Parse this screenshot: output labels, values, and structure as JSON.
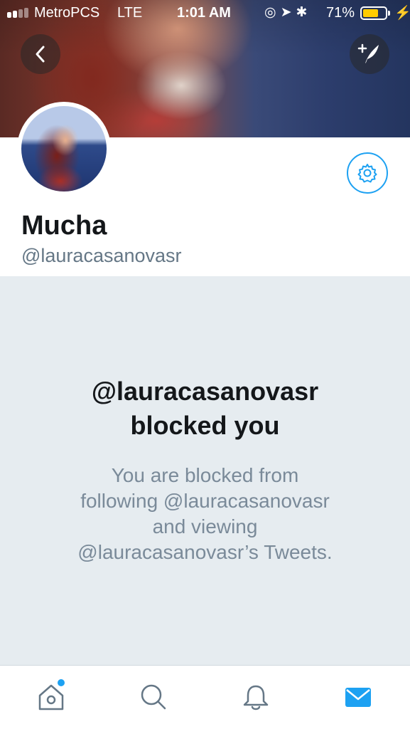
{
  "status_bar": {
    "carrier": "MetroPCS",
    "network": "LTE",
    "time": "1:01 AM",
    "battery_percent": "71%",
    "battery_level": 0.71,
    "icons": [
      "signal-icon",
      "lock-rotation-icon",
      "location-icon",
      "bluetooth-icon",
      "battery-icon",
      "charging-icon"
    ]
  },
  "header": {
    "back_icon": "back-arrow-icon",
    "compose_icon": "compose-tweet-icon"
  },
  "profile": {
    "display_name": "Mucha",
    "handle": "@lauracasanovasr",
    "settings_icon": "gear-icon"
  },
  "blocked": {
    "title_line1": "@lauracasanovasr",
    "title_line2": "blocked you",
    "desc_line1": "You are blocked from",
    "desc_line2": "following @lauracasanovasr",
    "desc_line3": "and viewing",
    "desc_line4": "@lauracasanovasr’s Tweets."
  },
  "tab_bar": {
    "tabs": [
      {
        "name": "home",
        "icon": "home-icon",
        "has_badge": true
      },
      {
        "name": "search",
        "icon": "search-icon"
      },
      {
        "name": "notifications",
        "icon": "bell-icon"
      },
      {
        "name": "messages",
        "icon": "envelope-icon",
        "active": true
      }
    ]
  },
  "colors": {
    "accent": "#1da1f2",
    "panel_bg": "#e6ecf0",
    "text_primary": "#14171a",
    "text_secondary": "#657786"
  }
}
